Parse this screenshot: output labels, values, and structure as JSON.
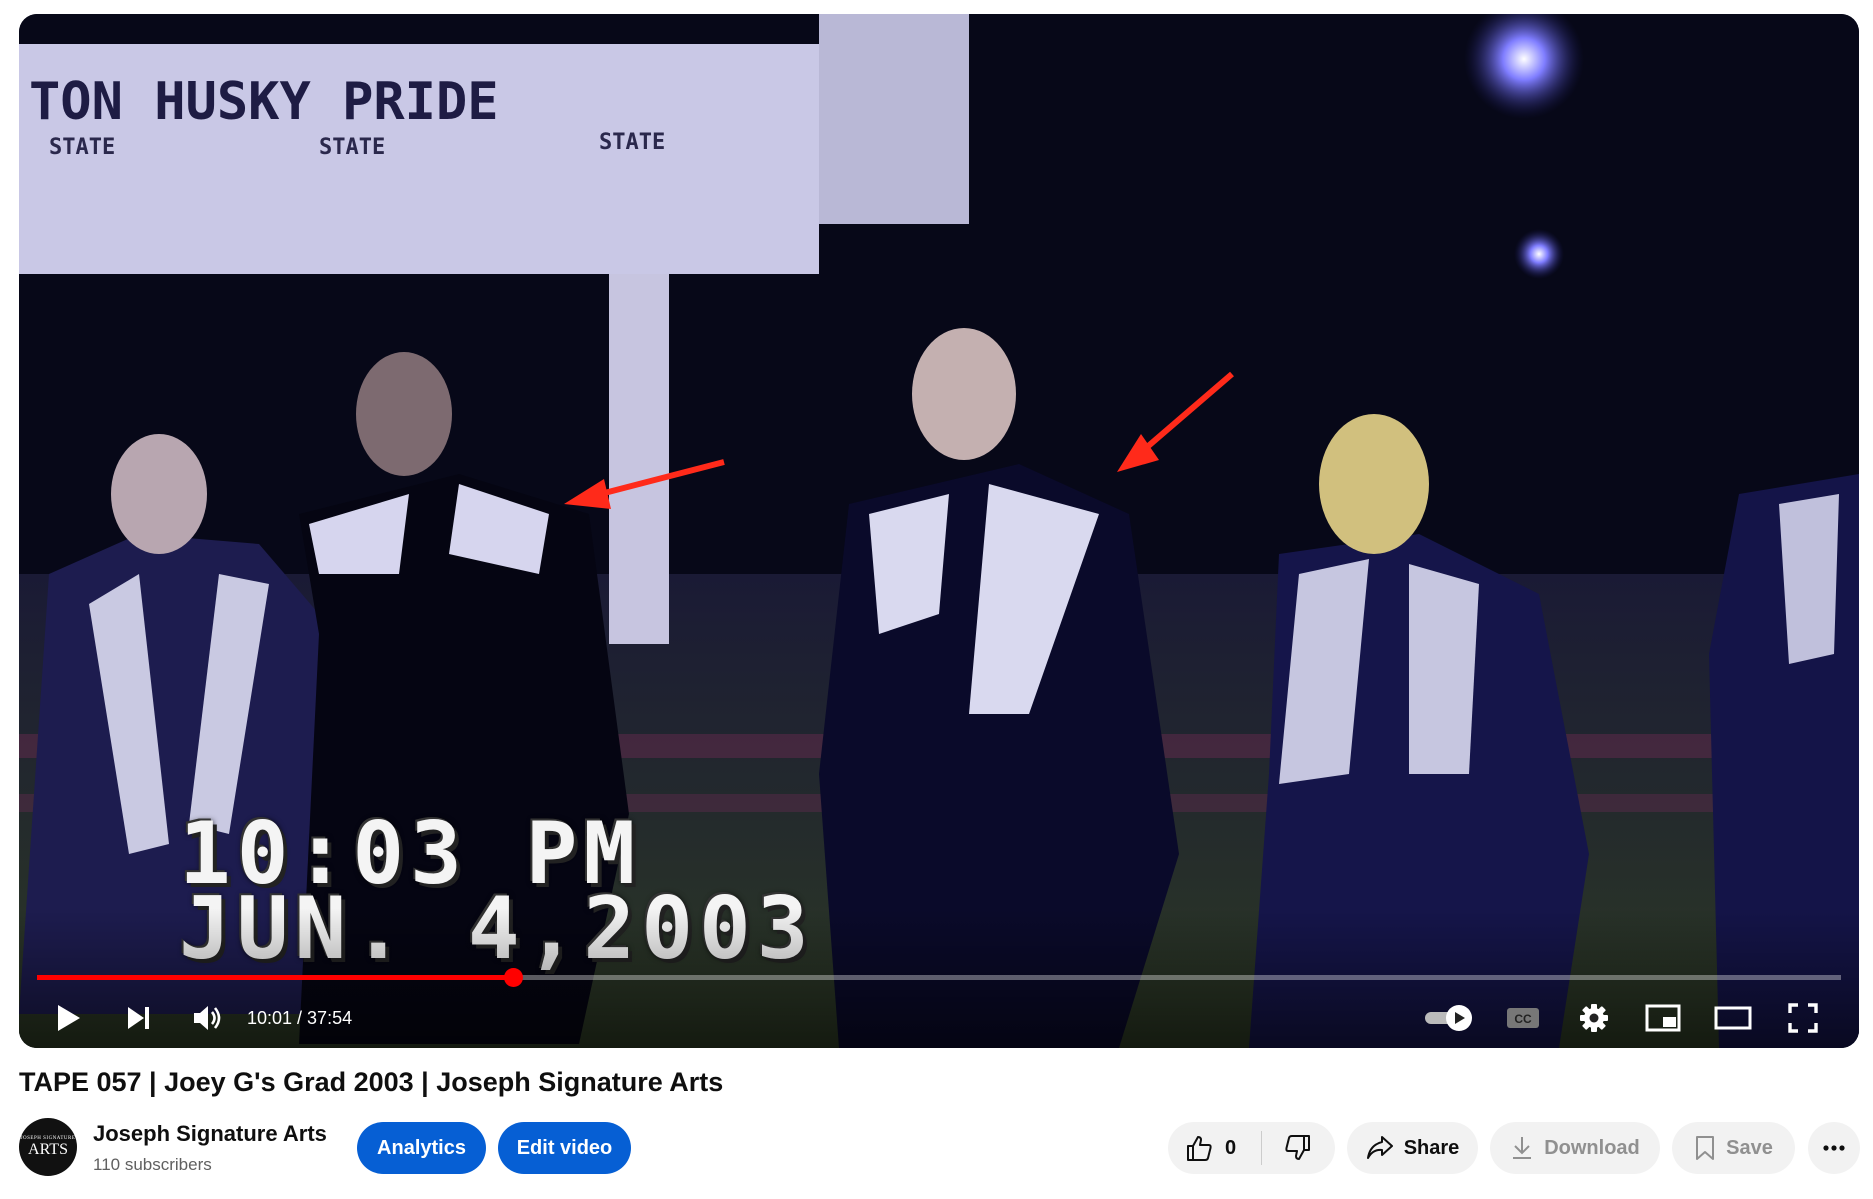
{
  "player": {
    "osd_time": "10:03 PM",
    "osd_date": "JUN. 4,2003",
    "current_time": "10:01",
    "duration": "37:54",
    "time_display": "10:01 / 37:54",
    "progress_fraction": 0.264,
    "accent_color": "#ff0000",
    "icons": [
      "play-icon",
      "next-icon",
      "volume-icon",
      "autoplay-toggle-icon",
      "captions-icon",
      "settings-icon",
      "miniplayer-icon",
      "theater-icon",
      "fullscreen-icon"
    ],
    "captions_label": "CC"
  },
  "video": {
    "title": "TAPE 057 | Joey G's Grad 2003 | Joseph Signature Arts"
  },
  "channel": {
    "name": "Joseph Signature Arts",
    "subscribers": "110 subscribers",
    "avatar_line1": "JOSEPH SIGNATURE",
    "avatar_line2": "ARTS"
  },
  "actions": {
    "analytics": "Analytics",
    "edit_video": "Edit video",
    "like_count": "0",
    "share": "Share",
    "download": "Download",
    "save": "Save",
    "blue_color": "#065fd4"
  }
}
